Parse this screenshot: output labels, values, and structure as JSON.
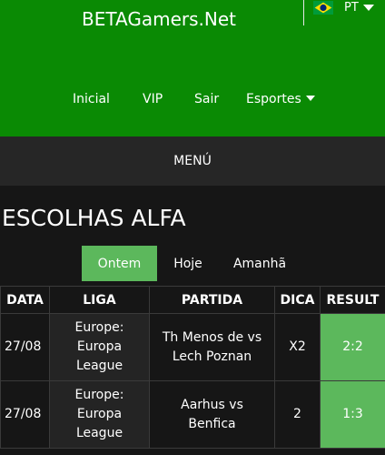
{
  "header": {
    "brand": "BETAGamers.Net",
    "lang_code": "PT",
    "colors": {
      "header_bg": "#0a8a04",
      "accent": "#5cb85c",
      "page_bg": "#161616"
    }
  },
  "nav": {
    "items": [
      {
        "label": "Inicial"
      },
      {
        "label": "VIP"
      },
      {
        "label": "Sair"
      },
      {
        "label": "Esportes"
      }
    ]
  },
  "menu": {
    "label": "MENÚ"
  },
  "page": {
    "title": "ESCOLHAS ALFA"
  },
  "tabs": [
    {
      "label": "Ontem",
      "active": true
    },
    {
      "label": "Hoje",
      "active": false
    },
    {
      "label": "Amanhã",
      "active": false
    }
  ],
  "table": {
    "headers": [
      "DATA",
      "LIGA",
      "PARTIDA",
      "DICA",
      "RESULT"
    ],
    "rows": [
      {
        "date": "27/08",
        "league": [
          "Europe:",
          "Europa",
          "League"
        ],
        "match": [
          "Th Menos de vs",
          "Lech Poznan"
        ],
        "tip": "X2",
        "result": "2:2"
      },
      {
        "date": "27/08",
        "league": [
          "Europe:",
          "Europa",
          "League"
        ],
        "match": [
          "Aarhus vs",
          "Benfica"
        ],
        "tip": "2",
        "result": "1:3"
      }
    ]
  }
}
